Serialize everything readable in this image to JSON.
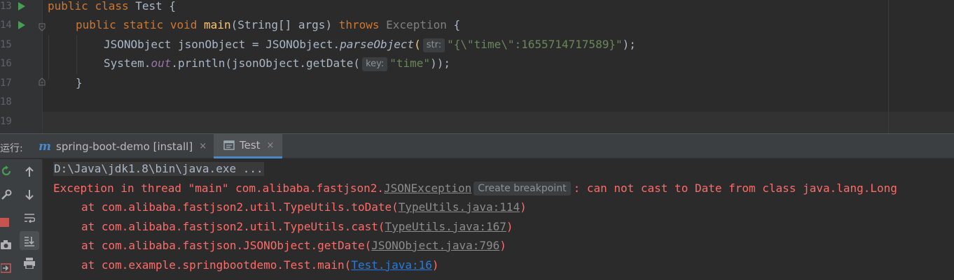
{
  "editor": {
    "line_numbers": [
      "13",
      "14",
      "15",
      "16",
      "17",
      "18",
      "19"
    ],
    "lines": {
      "l13": {
        "public": "public",
        "class": "class",
        "name": "Test",
        "brace": "{"
      },
      "l14": {
        "public": "public",
        "static": "static",
        "void": "void",
        "main": "main",
        "params": "(String[] args)",
        "throws": "throws",
        "exception": "Exception",
        "brace": "{"
      },
      "l15": {
        "decl": "JSONObject jsonObject = JSONObject.",
        "method": "parseObject",
        "open": "(",
        "hint": "str:",
        "literal": "\"{\\\"time\\\":1655714717589}\"",
        "close": ");"
      },
      "l16": {
        "system": "System.",
        "out": "out",
        "call": ".println(jsonObject.getDate(",
        "hint": "key:",
        "literal": "\"time\"",
        "close": "));"
      },
      "l17": {
        "brace": "}"
      }
    }
  },
  "run_window": {
    "label": "运行:",
    "tabs": [
      {
        "label": "spring-boot-demo [install]",
        "icon": "maven-icon"
      },
      {
        "label": "Test",
        "icon": "console-icon"
      }
    ],
    "close_glyph": "×"
  },
  "console": {
    "command": "D:\\Java\\jdk1.8\\bin\\java.exe ...",
    "exception_prefix": "Exception in thread \"main\" com.alibaba.fastjson2.",
    "exception_class": "JSONException",
    "breakpoint_hint": "Create breakpoint",
    "exception_message": ": can not cast to Date from class java.lang.Long",
    "stack": [
      {
        "text": "at com.alibaba.fastjson2.util.TypeUtils.toDate(",
        "link": "TypeUtils.java:114",
        "end": ")"
      },
      {
        "text": "at com.alibaba.fastjson2.util.TypeUtils.cast(",
        "link": "TypeUtils.java:167",
        "end": ")"
      },
      {
        "text": "at com.alibaba.fastjson.JSONObject.getDate(",
        "link": "JSONObject.java:796",
        "end": ")"
      },
      {
        "text": "at com.example.springbootdemo.Test.main(",
        "link": "Test.java:16",
        "end": ")"
      }
    ]
  },
  "colors": {
    "error": "#ff6b68",
    "keyword": "#cc7832",
    "string": "#6a8759",
    "method": "#ffc66d",
    "link": "#287bde"
  }
}
